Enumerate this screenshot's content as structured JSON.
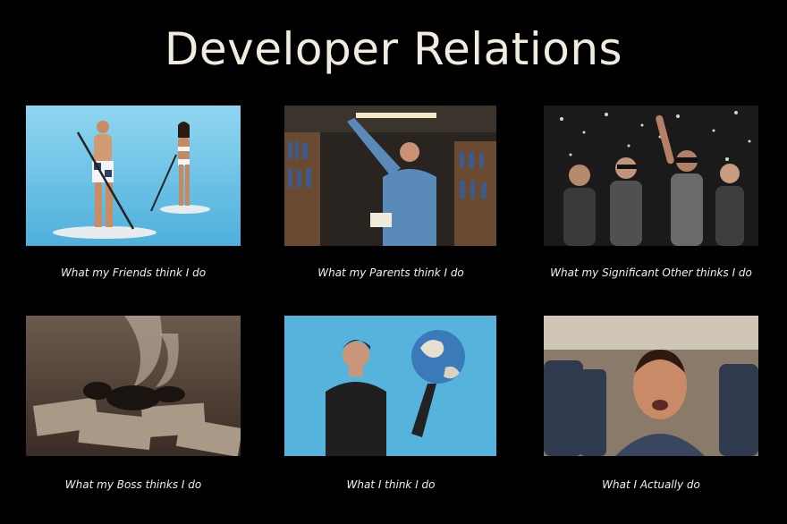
{
  "title": "Developer Relations",
  "panels": [
    {
      "caption": "What my Friends think I do",
      "image": "paddleboarding-photo"
    },
    {
      "caption": "What my Parents think I do",
      "image": "library-photo"
    },
    {
      "caption": "What my Significant Other thinks I do",
      "image": "party-photo"
    },
    {
      "caption": "What my Boss thinks I do",
      "image": "burning-money-photo"
    },
    {
      "caption": "What I think I do",
      "image": "holding-globe-photo"
    },
    {
      "caption": "What I Actually do",
      "image": "sleeping-on-plane-photo"
    }
  ]
}
